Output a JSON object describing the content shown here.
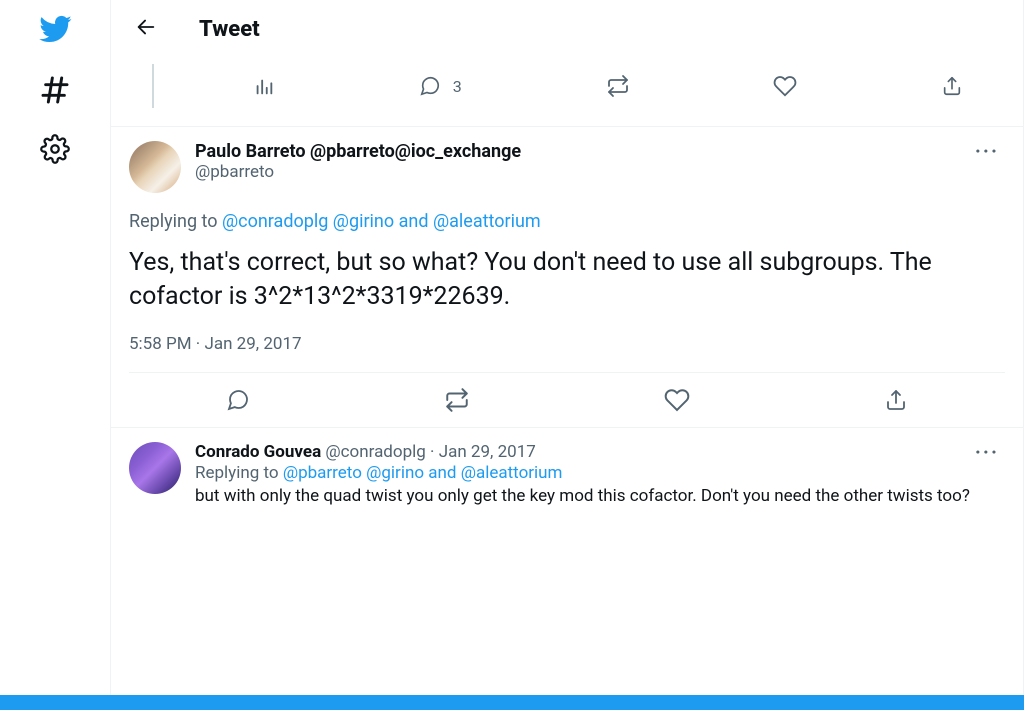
{
  "header": {
    "title": "Tweet"
  },
  "prev_tweet": {
    "reply_count": "3"
  },
  "main_tweet": {
    "display_name": "Paulo Barreto @pbarreto@ioc_exchange",
    "handle": "@pbarreto",
    "reply_prefix": "Replying to ",
    "mentions_1": "@conradoplg",
    "mentions_2": "@girino",
    "mentions_and": " and ",
    "mentions_3": "@aleattorium",
    "body": "Yes, that's correct, but so what? You don't need to use all subgroups. The cofactor is 3^2*13^2*3319*22639.",
    "time": "5:58 PM · Jan 29, 2017"
  },
  "reply_tweet": {
    "name": "Conrado Gouvea",
    "meta": " @conradoplg · Jan 29, 2017",
    "reply_prefix": "Replying to ",
    "mentions_1": "@pbarreto",
    "mentions_2": "@girino",
    "mentions_and": " and ",
    "mentions_3": "@aleattorium",
    "body": "but with only the quad twist you only get the key mod this cofactor. Don't you need the other twists too?"
  }
}
